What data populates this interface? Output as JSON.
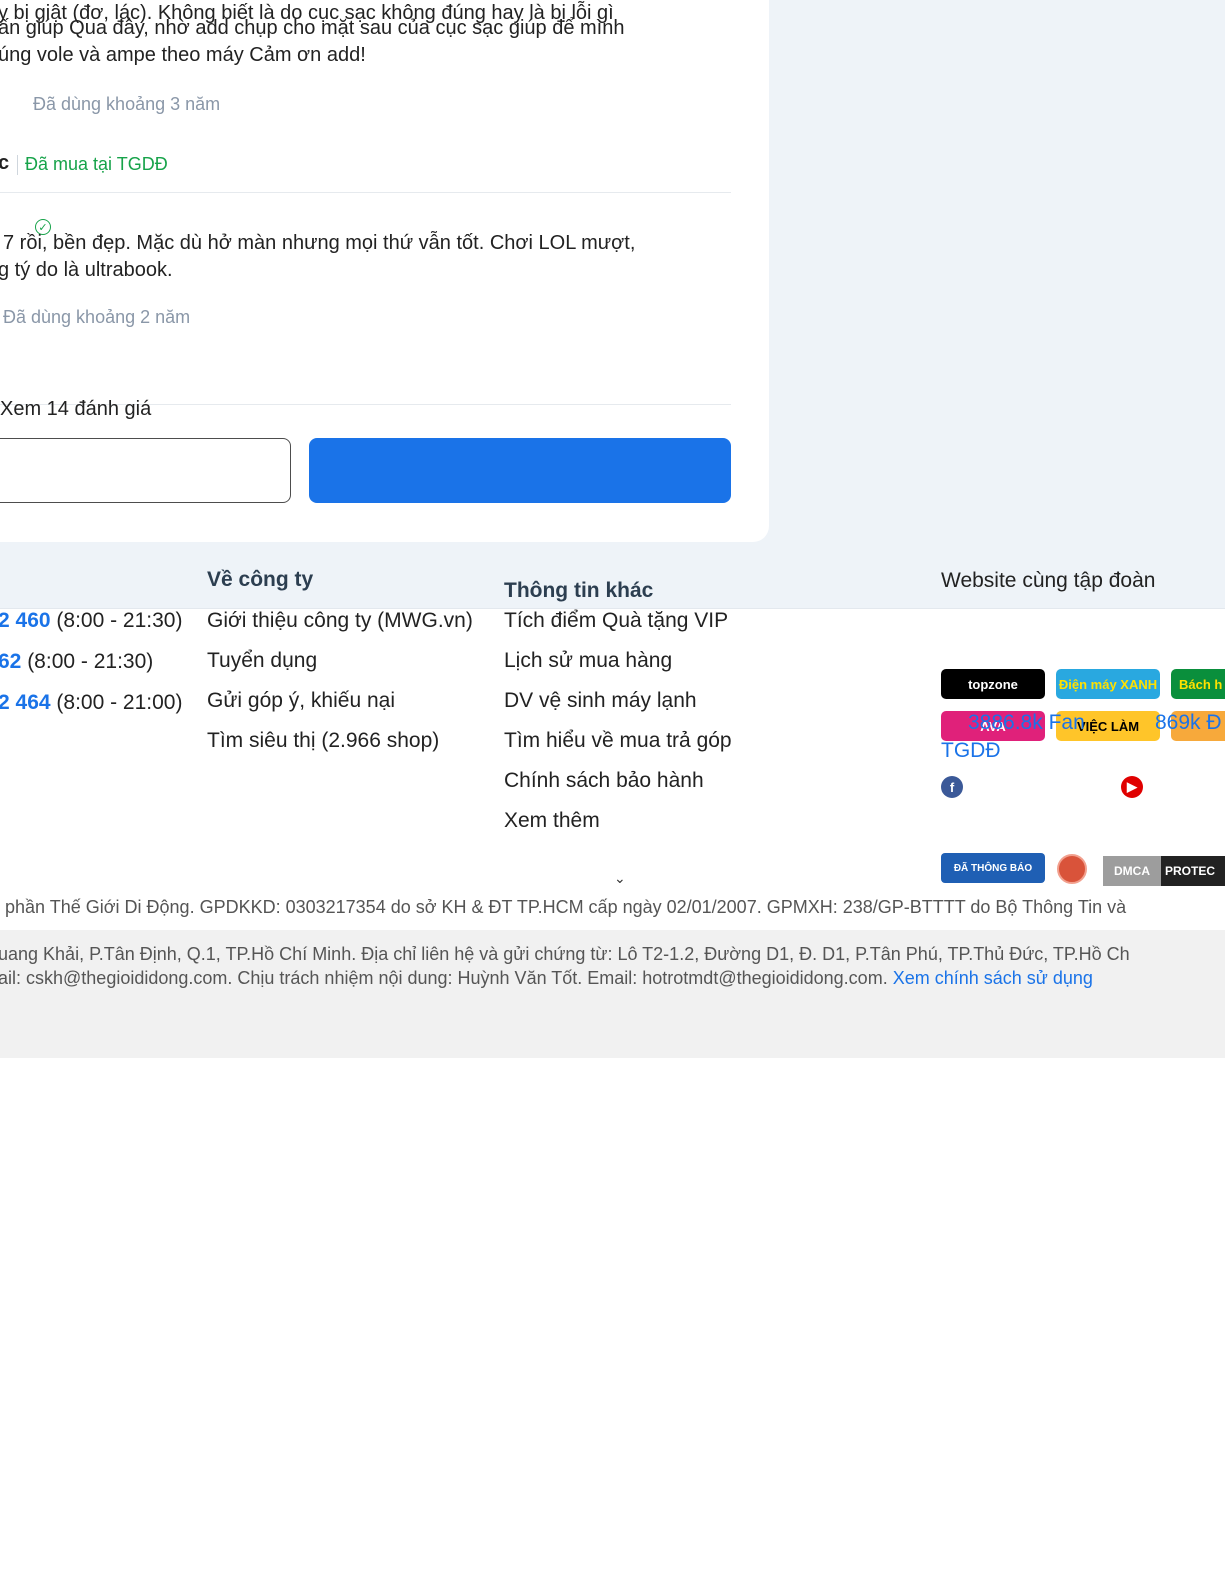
{
  "reviews": [
    {
      "lines": [
        "y bị giật (đơ, lác).   Không biết là do cục sạc không đúng hay là bị lỗi gì",
        "ấn giúp  Qua đây, nhờ add chụp cho mặt sau của cục sạc giúp để mình",
        "úng vole và ampe theo máy  Cảm ơn add!"
      ],
      "usage": "Đã dùng khoảng 3 năm"
    },
    {
      "reviewer": "c",
      "bought": "Đã mua tại TGDĐ",
      "lines": [
        "7 rồi, bền đẹp. Mặc dù hở màn nhưng mọi thứ vẫn tốt. Chơi LOL mượt,",
        "g tý do là ultrabook."
      ],
      "usage": "Đã dùng khoảng 2 năm"
    }
  ],
  "see_all": "Xem 14 đánh giá",
  "footer": {
    "support_lines": [
      {
        "phone": "2 460",
        "hours": " (8:00 - 21:30)"
      },
      {
        "phone": "62",
        "hours": " (8:00 - 21:30)"
      },
      {
        "phone": "2 464",
        "hours": " (8:00 - 21:00)"
      }
    ],
    "company": {
      "title": "Về công ty",
      "links": [
        "Giới thiệu công ty (MWG.vn)",
        "Tuyển dụng",
        "Gửi góp ý, khiếu nại",
        "Tìm siêu thị (2.966 shop)"
      ]
    },
    "other": {
      "title": "Thông tin khác",
      "links": [
        "Tích điểm Quà tặng VIP",
        "Lịch sử mua hàng",
        "DV vệ sinh máy lạnh",
        "Tìm hiểu về mua trả góp",
        "Chính sách bảo hành",
        "Xem thêm"
      ]
    },
    "group": {
      "title": "Website cùng tập đoàn",
      "logos": [
        {
          "label": "topzone",
          "bg": "#000000",
          "fg": "#ffffff"
        },
        {
          "label": "Điện máy XANH",
          "bg": "#29a8e0",
          "fg": "#ffe100"
        },
        {
          "label": "Bách h",
          "bg": "#0a8f3c",
          "fg": "#ffe100"
        },
        {
          "label": "AVA",
          "bg": "#e0217a",
          "fg": "#ffffff"
        },
        {
          "label": "VIỆC LÀM",
          "bg": "#ffc529",
          "fg": "#000000"
        },
        {
          "label": "",
          "bg": "#f7a93b",
          "fg": "#ffffff"
        }
      ]
    },
    "social": {
      "facebook_count": "3886.8k Fan",
      "youtube_count": "869k Đ",
      "tgdd_label": "TGDĐ"
    },
    "badges": [
      "ĐÃ THÔNG BÁO",
      "DMCA",
      "PROTEC"
    ],
    "legal": {
      "line1": "phần Thế Giới Di Động. GPDKKD: 0303217354 do sở KH & ĐT TP.HCM cấp ngày 02/01/2007. GPMXH: 238/GP-BTTTT do Bộ Thông Tin và",
      "line2": "uang Khải, P.Tân Định, Q.1, TP.Hồ Chí Minh. Địa chỉ liên hệ và gửi chứng từ: Lô T2-1.2, Đường D1, Đ. D1, P.Tân Phú, TP.Thủ Đức, TP.Hồ Ch",
      "line3": "ail: cskh@thegioididong.com. Chịu trách nhiệm nội dung: Huỳnh Văn Tốt. Email: hotrotmdt@thegioididong.com. ",
      "policy_link": "Xem chính sách sử dụng"
    }
  }
}
